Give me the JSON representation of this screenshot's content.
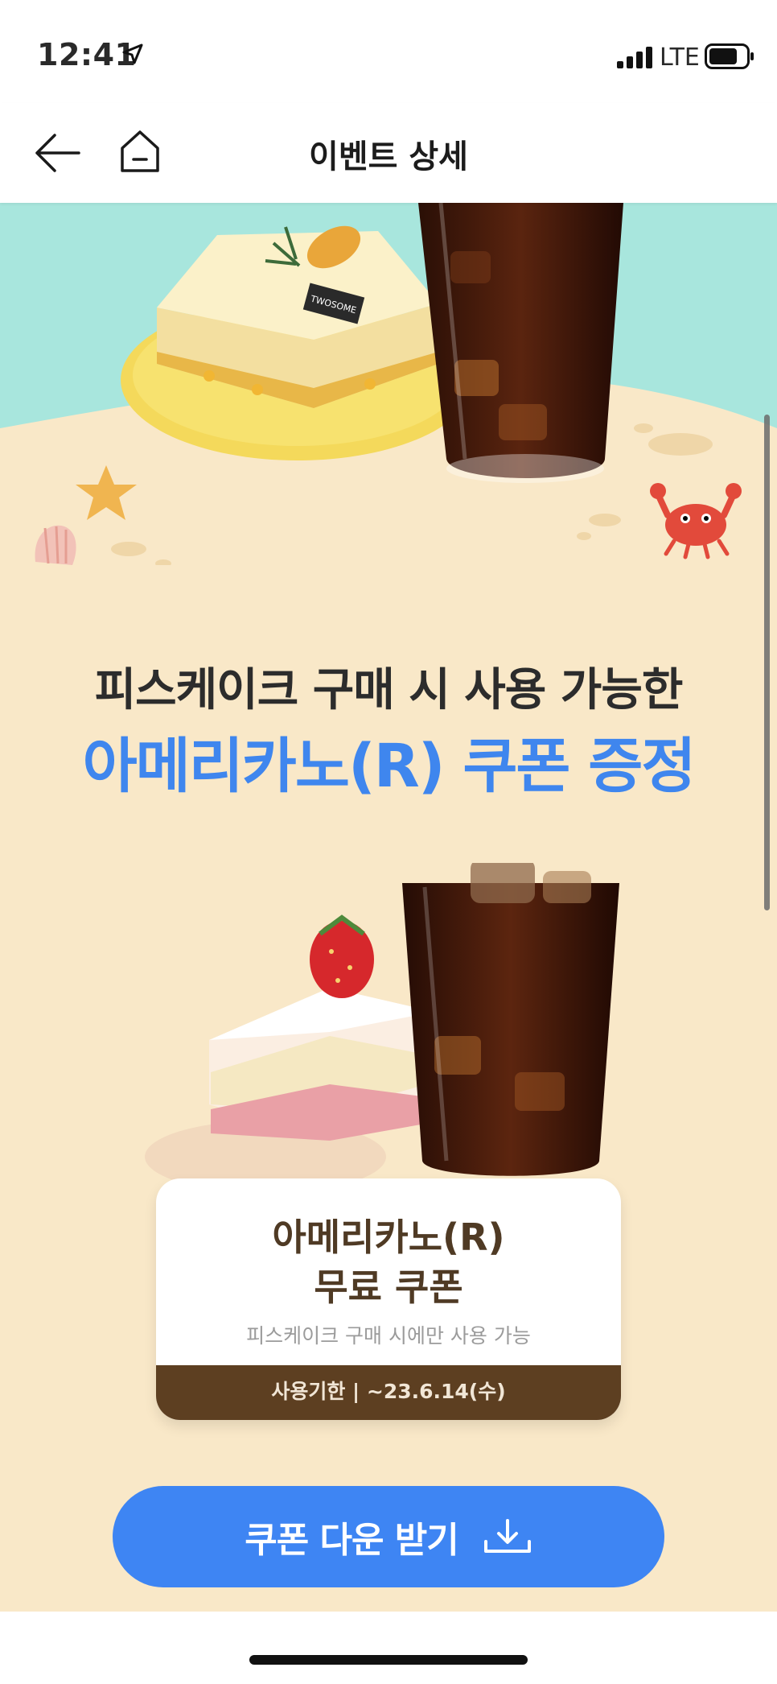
{
  "status_bar": {
    "time": "12:41",
    "network": "LTE",
    "icons": [
      "location-arrow-icon",
      "cellular-signal-icon",
      "battery-icon"
    ]
  },
  "nav": {
    "title": "이벤트 상세",
    "back_icon": "arrow-left-icon",
    "home_icon": "home-icon"
  },
  "hero": {
    "cake_topper": "TWOSOME",
    "decorations": [
      "starfish-icon",
      "seashell-icon",
      "crab-icon"
    ]
  },
  "headline": {
    "line1": "피스케이크 구매 시 사용 가능한",
    "line2": "아메리카노(R) 쿠폰 증정"
  },
  "coupon": {
    "title": "아메리카노(R)\n무료 쿠폰",
    "condition": "피스케이크 구매 시에만 사용 가능",
    "expiry": "사용기한 | ~23.6.14(수)"
  },
  "download_button": {
    "label": "쿠폰 다운 받기",
    "icon": "download-icon"
  },
  "colors": {
    "accent_blue": "#3f86ee",
    "sand_background": "#f9e8c8",
    "sea_mint": "#a8e6dd",
    "coupon_brown": "#5d3f21"
  }
}
